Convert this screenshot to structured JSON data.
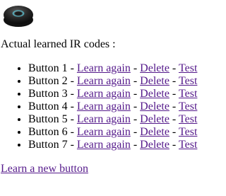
{
  "device_image": {
    "description_icon": "ir-blaster-device-icon",
    "led_color": "#5fd3e6"
  },
  "heading": "Actual learned IR codes :",
  "separator": "-",
  "buttons": [
    {
      "label": "Button 1",
      "learn": "Learn again",
      "delete": "Delete",
      "test": "Test"
    },
    {
      "label": "Button 2",
      "learn": "Learn again",
      "delete": "Delete",
      "test": "Test"
    },
    {
      "label": "Button 3",
      "learn": "Learn again",
      "delete": "Delete",
      "test": "Test"
    },
    {
      "label": "Button 4",
      "learn": "Learn again",
      "delete": "Delete",
      "test": "Test"
    },
    {
      "label": "Button 5",
      "learn": "Learn again",
      "delete": "Delete",
      "test": "Test"
    },
    {
      "label": "Button 6",
      "learn": "Learn again",
      "delete": "Delete",
      "test": "Test"
    },
    {
      "label": "Button 7",
      "learn": "Learn again",
      "delete": "Delete",
      "test": "Test"
    }
  ],
  "learn_new_link": "Learn a new button",
  "colors": {
    "link": "#551a8b",
    "text": "#000000",
    "background": "#ffffff"
  }
}
